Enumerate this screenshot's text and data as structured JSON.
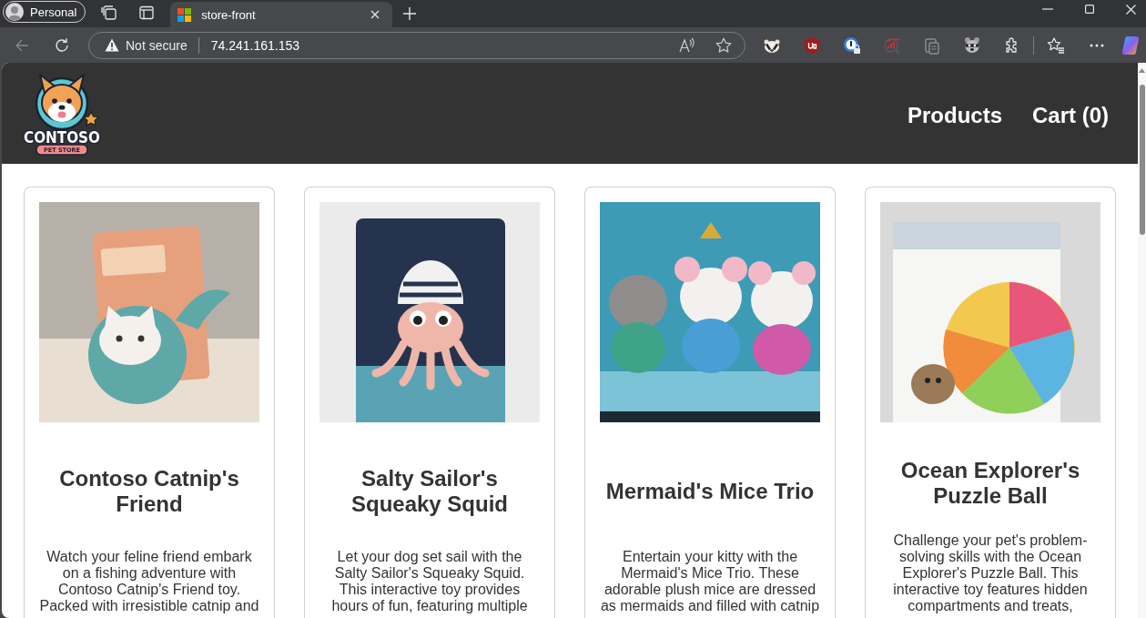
{
  "browser": {
    "profile": {
      "label": "Personal"
    },
    "tabs": [
      {
        "title": "store-front",
        "selected": true
      }
    ],
    "nav_buttons": [
      {
        "kind": "back",
        "disabled": true
      },
      {
        "kind": "refresh",
        "disabled": false
      }
    ],
    "address_bar": {
      "security": "Not secure",
      "url": "74.241.161.153"
    }
  },
  "header": {
    "logo": {
      "name": "CONTOSO",
      "tagline": "PET STORE"
    },
    "nav": [
      {
        "label": "Products"
      },
      {
        "label": "Cart (0)"
      }
    ]
  },
  "products": [
    {
      "title": "Contoso Catnip's Friend",
      "description": "Watch your feline friend embark on a fishing adventure with Contoso Catnip's Friend toy. Packed with irresistible catnip and"
    },
    {
      "title": "Salty Sailor's Squeaky Squid",
      "description": "Let your dog set sail with the Salty Sailor's Squeaky Squid. This interactive toy provides hours of fun, featuring multiple"
    },
    {
      "title": "Mermaid's Mice Trio",
      "description": "Entertain your kitty with the Mermaid's Mice Trio. These adorable plush mice are dressed as mermaids and filled with catnip"
    },
    {
      "title": "Ocean Explorer's Puzzle Ball",
      "description": "Challenge your pet's problem-solving skills with the Ocean Explorer's Puzzle Ball. This interactive toy features hidden compartments and treats,"
    }
  ]
}
